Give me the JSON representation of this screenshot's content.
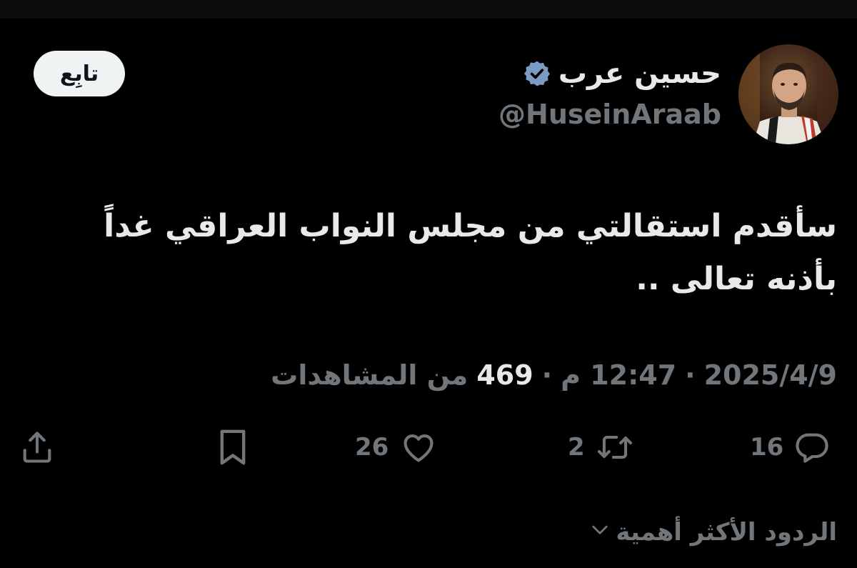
{
  "user": {
    "display_name": "حسين عرب",
    "handle": "@HuseinAraab",
    "verified_icon": "verified-badge-icon",
    "verified_color": "#7c9bc4"
  },
  "follow_button": {
    "label": "تابِع"
  },
  "tweet": {
    "line1": "سأقدم استقالتي من مجلس النواب العراقي غداً",
    "line2": "بأذنه تعالى .."
  },
  "meta": {
    "date": "2025/4/9",
    "separator": "·",
    "time": "12:47 م",
    "views_count": "469",
    "views_label": "من المشاهدات"
  },
  "actions": {
    "reply_count": "16",
    "retweet_count": "2",
    "like_count": "26",
    "icons": [
      "reply-icon",
      "retweet-icon",
      "like-icon",
      "bookmark-icon",
      "share-icon"
    ]
  },
  "replies_sort": {
    "label": "الردود الأكثر أهمية"
  },
  "colors": {
    "background": "#000000",
    "primary_text": "#e7e9ea",
    "secondary_text": "#71767b",
    "button_bg": "#eff3f4"
  }
}
